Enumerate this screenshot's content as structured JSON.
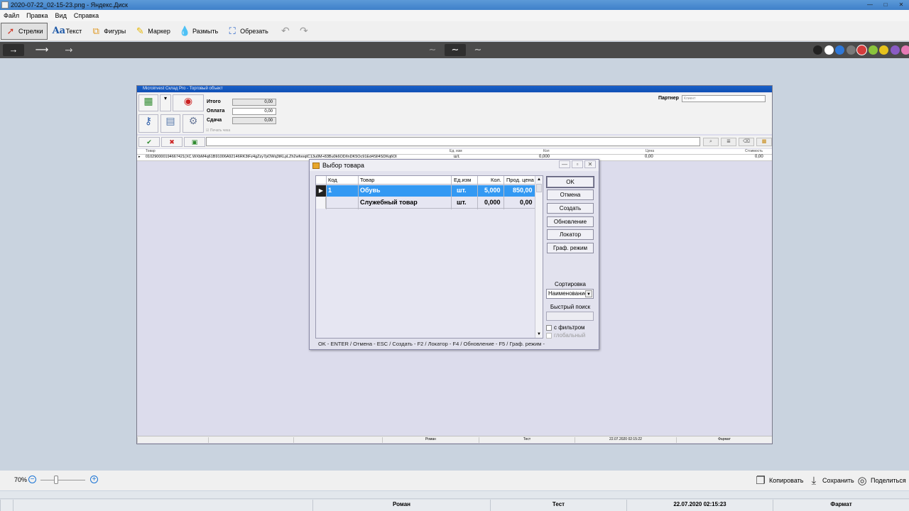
{
  "window": {
    "title": "2020-07-22_02-15-23.png - Яндекс.Диск",
    "controls": [
      "—",
      "□",
      "✕"
    ]
  },
  "menu": [
    "Файл",
    "Правка",
    "Вид",
    "Справка"
  ],
  "tools": [
    {
      "label": "Стрелки",
      "icon": "arrow-icon",
      "active": true
    },
    {
      "label": "Текст",
      "icon": "text-icon",
      "active": false
    },
    {
      "label": "Фигуры",
      "icon": "shapes-icon",
      "active": false
    },
    {
      "label": "Маркер",
      "icon": "marker-icon",
      "active": false
    },
    {
      "label": "Размыть",
      "icon": "blur-icon",
      "active": false
    },
    {
      "label": "Обрезать",
      "icon": "crop-icon",
      "active": false
    }
  ],
  "history": {
    "undo": "↶",
    "redo": "↷"
  },
  "line_styles": {
    "arrows": [
      "→",
      "⟶",
      "⤑"
    ],
    "thickness": [
      "∼",
      "∼",
      "∼"
    ]
  },
  "palette": [
    "#222222",
    "#ffffff",
    "#2f78d8",
    "#7a7a7a",
    "#d23c3c",
    "#8ac43c",
    "#e6c21c",
    "#8a5cc4",
    "#e67ab5"
  ],
  "app": {
    "title": "Microinvest Склад Pro - Торговый объект",
    "summary": [
      {
        "label": "Итого",
        "value": "0,00"
      },
      {
        "label": "Оплата",
        "value": "0,00"
      },
      {
        "label": "Сдача",
        "value": "0,00"
      }
    ],
    "print_receipt": "Печать чека",
    "partner_label": "Партнер",
    "partner_value": "Клиент",
    "grid_headers": {
      "product": "Товар",
      "unit": "Ед. изм",
      "qty": "Кол",
      "price": "Цена",
      "total": "Стоимость"
    },
    "grid_row": {
      "product": "0102900001946674​21(XC.WXbM4q61B91006A92146RK3tFz4gZzy7pOWq3tKLpLZh2wfooqtC13u0M+83Bu0k6OD/lnDK5Oc91Ed4SIl4SDKq6Ol",
      "unit": "шт.",
      "qty": "0,000",
      "price": "0,00",
      "total": "0,00"
    },
    "status": [
      "",
      "",
      "",
      "Роман",
      "Тест",
      "22.07.2020 02:15:22",
      "Фармат"
    ]
  },
  "dialog": {
    "title": "Выбор товара",
    "headers": {
      "code": "Код",
      "product": "Товар",
      "unit": "Ед.изм",
      "qty": "Кол.",
      "price": "Прод. цена"
    },
    "rows": [
      {
        "code": "1",
        "product": "Обувь",
        "unit": "шт.",
        "qty": "5,000",
        "price": "850,00"
      },
      {
        "code": "",
        "product": "Служебный товар",
        "unit": "шт.",
        "qty": "0,000",
        "price": "0,00"
      }
    ],
    "buttons": [
      "OK",
      "Отмена",
      "Создать",
      "Обновление",
      "Локатор",
      "Граф. режим"
    ],
    "sort_label": "Сортировка",
    "sort_value": "Наименование",
    "quick_search_label": "Быстрый поиск",
    "quick_search_value": "",
    "filter_label": "с фильтром",
    "global_label": "глобальный",
    "hotkeys": "OK - ENTER / Отмена - ESC / Создать - F2 / Локатор - F4 / Обновление - F5 / Граф. режим -"
  },
  "zoom": {
    "percent": "70%",
    "level": 0.35
  },
  "actions": [
    {
      "label": "Копировать",
      "icon": "copy-icon"
    },
    {
      "label": "Сохранить",
      "icon": "download-icon"
    },
    {
      "label": "Поделиться",
      "icon": "share-icon"
    }
  ],
  "status": [
    "",
    "",
    "Роман",
    "Тест",
    "22.07.2020 02:15:23",
    "Фармат"
  ]
}
